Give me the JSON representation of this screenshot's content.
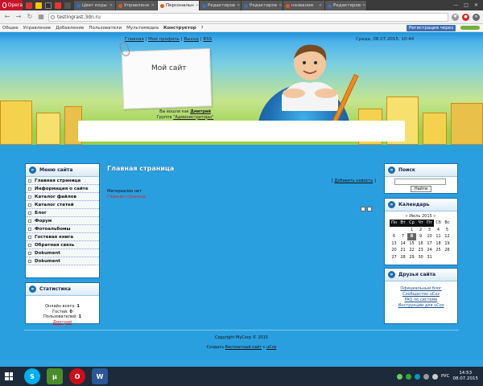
{
  "browser": {
    "menu_label": "Opera",
    "tabs": [
      {
        "label": "Цвет коды",
        "color": "#1a73e8"
      },
      {
        "label": "Управлени",
        "color": "#e05a1a"
      },
      {
        "label": "Персональн",
        "color": "#e05a1a",
        "active": true
      },
      {
        "label": "Редактиров",
        "color": "#3d6fb3"
      },
      {
        "label": "Редактиров",
        "color": "#3d6fb3"
      },
      {
        "label": "названия",
        "color": "#e05a1a"
      },
      {
        "label": "Редактиров",
        "color": "#3d6fb3"
      }
    ],
    "url": "testingrast.3dn.ru",
    "controls": {
      "min": "—",
      "max": "□",
      "close": "✕"
    }
  },
  "ucoz_panel": {
    "items": [
      "Общее",
      "Управление",
      "Добавление",
      "Пользователи",
      "Мультимедиа"
    ],
    "constructor": "Конструктор",
    "help": "?",
    "register": "Регистрация через"
  },
  "site": {
    "top_links": {
      "home": "Главная",
      "profile": "Мой профиль",
      "logout": "Выход",
      "rss": "RSS",
      "sep": "|"
    },
    "date": "Среда, 08.07.2015, 10:44",
    "title": "Мой сайт",
    "logged_in_prefix": "Вы вошли как",
    "user": "Дмитрий",
    "group_prefix": "Группа",
    "group": "\"Администраторы\""
  },
  "left": {
    "menu_title": "Меню сайта",
    "menu": [
      "Главная страница",
      "Информация о сайте",
      "Каталог файлов",
      "Каталог статей",
      "Блог",
      "Форум",
      "Фотоальбомы",
      "Гостевая книга",
      "Обратная связь",
      "Dokument",
      "Dokument"
    ],
    "stats_title": "Статистика",
    "stats": {
      "online_label": "Онлайн всего:",
      "online": "1",
      "guests_label": "Гостей:",
      "guests": "0",
      "users_label": "Пользователей:",
      "users": "1",
      "user_link": "Дмитрий"
    }
  },
  "center": {
    "page_title": "Главная страница",
    "add_news_open": "[ ",
    "add_news": "Добавить новость",
    "add_news_close": " ]",
    "no_materials": "Материалов нет",
    "red_link": "Главная страница"
  },
  "right": {
    "search_title": "Поиск",
    "search_button": "Найти",
    "calendar_title": "Календарь",
    "calendar_month": "«  Июль 2015  »",
    "weekdays": [
      "Пн",
      "Вт",
      "Ср",
      "Чт",
      "Пт",
      "Сб",
      "Вс"
    ],
    "weeks": [
      [
        "",
        "",
        "1",
        "2",
        "3",
        "4",
        "5"
      ],
      [
        "6",
        "7",
        "8",
        "9",
        "10",
        "11",
        "12"
      ],
      [
        "13",
        "14",
        "15",
        "16",
        "17",
        "18",
        "19"
      ],
      [
        "20",
        "21",
        "22",
        "23",
        "24",
        "25",
        "26"
      ],
      [
        "27",
        "28",
        "29",
        "30",
        "31",
        "",
        ""
      ]
    ],
    "today": "8",
    "friends_title": "Друзья сайта",
    "friends": [
      "Официальный блог",
      "Сообщество uCoz",
      "FAQ по системе",
      "Инструкции для uCoz"
    ]
  },
  "footer": {
    "copyright": "Copyright MyCorp © 2015",
    "create_prefix": "Создать",
    "create_link": "бесплатный сайт",
    "create_suffix": "с",
    "ucoz": "uCoz"
  },
  "taskbar": {
    "lang": "РУС",
    "time": "14:53",
    "date": "08.07.2015"
  }
}
